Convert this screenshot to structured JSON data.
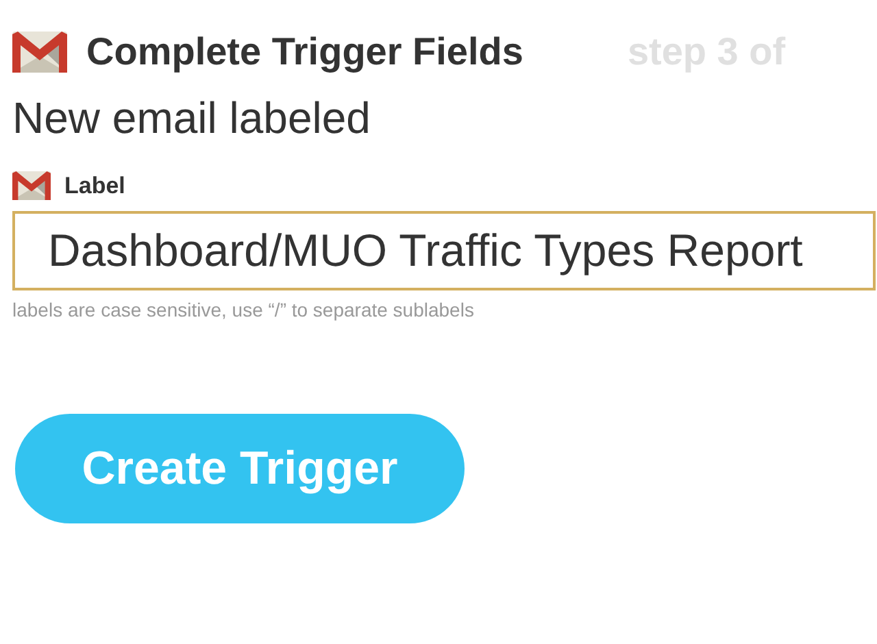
{
  "header": {
    "title": "Complete Trigger Fields",
    "step": "step 3 of"
  },
  "trigger_name": "New email labeled",
  "field": {
    "label": "Label",
    "value": "Dashboard/MUO Traffic Types Report",
    "hint": "labels are case sensitive, use “/” to separate sublabels"
  },
  "button": "Create Trigger"
}
